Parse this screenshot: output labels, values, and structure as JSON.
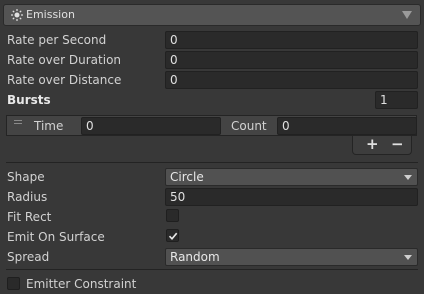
{
  "module": {
    "title": "Emission",
    "icon": "sun-icon",
    "collapse_icon": "triangle-down-icon"
  },
  "emission": {
    "rate_per_second_label": "Rate per Second",
    "rate_per_second_value": "0",
    "rate_over_duration_label": "Rate over Duration",
    "rate_over_duration_value": "0",
    "rate_over_distance_label": "Rate over Distance",
    "rate_over_distance_value": "0"
  },
  "bursts": {
    "label": "Bursts",
    "count": "1",
    "rows": [
      {
        "time_label": "Time",
        "time_value": "0",
        "count_label": "Count",
        "count_value": "0"
      }
    ],
    "add_label": "+",
    "remove_label": "−"
  },
  "shape": {
    "shape_label": "Shape",
    "shape_value": "Circle",
    "radius_label": "Radius",
    "radius_value": "50",
    "fit_rect_label": "Fit Rect",
    "fit_rect_checked": false,
    "emit_on_surface_label": "Emit On Surface",
    "emit_on_surface_checked": true,
    "spread_label": "Spread",
    "spread_value": "Random"
  },
  "emitter_constraint": {
    "label": "Emitter Constraint",
    "checked": false
  },
  "colors": {
    "panel_bg": "#383838",
    "header_bg": "#545454",
    "field_bg": "#2a2a2a",
    "dropdown_bg": "#515151"
  }
}
